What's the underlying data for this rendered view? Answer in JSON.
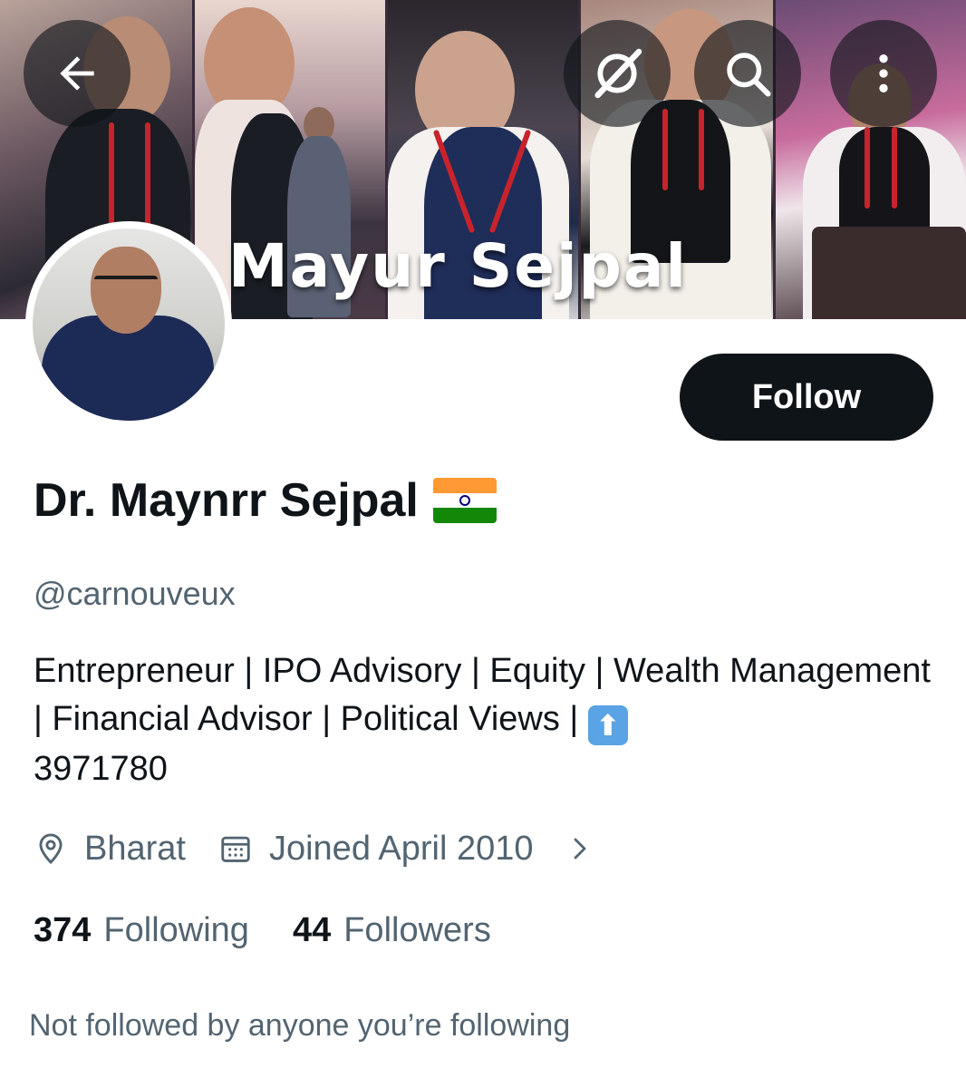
{
  "banner": {
    "title": "Mayur Sejpal"
  },
  "icons": {
    "back": "arrow-left-icon",
    "grok": "grok-icon",
    "search": "search-icon",
    "more": "more-vertical-icon",
    "location": "location-pin-icon",
    "calendar": "calendar-icon",
    "chevron": "chevron-right-icon"
  },
  "profile": {
    "display_name": "Dr. Maynrr Sejpal",
    "handle": "@carnouveux",
    "bio_text": "Entrepreneur | IPO Advisory | Equity | Wealth Management | Financial Advisor | Political Views | ",
    "bio_suffix": "3971780",
    "location": "Bharat",
    "joined": "Joined April 2010",
    "following_count": "374",
    "following_label": "Following",
    "followers_count": "44",
    "followers_label": "Followers",
    "not_followed_text": "Not followed by anyone you’re following"
  },
  "actions": {
    "follow_label": "Follow"
  },
  "colors": {
    "primary_text": "#0f1419",
    "secondary_text": "#536471",
    "button_bg": "#0f1419"
  }
}
